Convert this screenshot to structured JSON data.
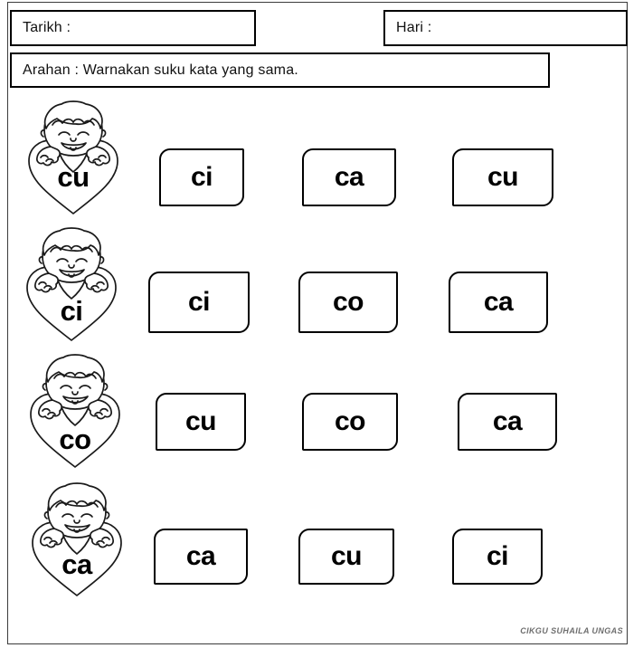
{
  "header": {
    "tarikh_label": "Tarikh :",
    "hari_label": "Hari :",
    "arahan_label": "Arahan : Warnakan suku kata yang sama."
  },
  "rows": [
    {
      "prompt": "cu",
      "options": [
        "ci",
        "ca",
        "cu"
      ]
    },
    {
      "prompt": "ci",
      "options": [
        "ci",
        "co",
        "ca"
      ]
    },
    {
      "prompt": "co",
      "options": [
        "cu",
        "co",
        "ca"
      ]
    },
    {
      "prompt": "ca",
      "options": [
        "ca",
        "cu",
        "ci"
      ]
    }
  ],
  "footer": {
    "watermark": "CIKGU SUHAILA UNGAS"
  }
}
